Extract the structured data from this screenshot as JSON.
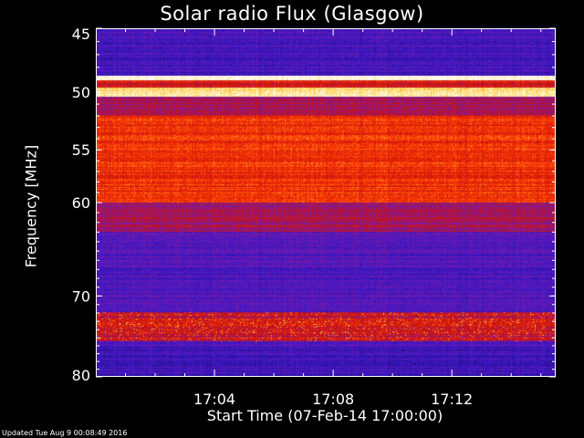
{
  "chart_data": {
    "type": "heatmap",
    "title": "Solar radio Flux (Glasgow)",
    "xlabel": "Start Time (07-Feb-14 17:00:00)",
    "ylabel": "Frequency [MHz]",
    "x_range_minutes": [
      0,
      15.5
    ],
    "x_ticks": [
      {
        "minutes": 4,
        "label": "17:04"
      },
      {
        "minutes": 8,
        "label": "17:08"
      },
      {
        "minutes": 12,
        "label": "17:12"
      }
    ],
    "y_range_mhz": [
      45,
      80
    ],
    "y_scale": "log",
    "y_ticks": [
      {
        "mhz": 45,
        "label": "45"
      },
      {
        "mhz": 50,
        "label": "50"
      },
      {
        "mhz": 55,
        "label": "55"
      },
      {
        "mhz": 60,
        "label": "60"
      },
      {
        "mhz": 70,
        "label": "70"
      },
      {
        "mhz": 80,
        "label": "80"
      }
    ],
    "colormap": [
      "#1e0a6e",
      "#3a18c8",
      "#7a1aa8",
      "#c81010",
      "#ff3c00",
      "#ffd040",
      "#ffffff"
    ],
    "bands": [
      {
        "from_mhz": 45,
        "to_mhz": 48.5,
        "level": 0.18
      },
      {
        "from_mhz": 48.6,
        "to_mhz": 49.0,
        "level": 1.0
      },
      {
        "from_mhz": 49.0,
        "to_mhz": 49.6,
        "level": 0.55
      },
      {
        "from_mhz": 49.6,
        "to_mhz": 50.3,
        "level": 0.9
      },
      {
        "from_mhz": 50.3,
        "to_mhz": 52.0,
        "level": 0.42
      },
      {
        "from_mhz": 52.0,
        "to_mhz": 60.0,
        "level": 0.62
      },
      {
        "from_mhz": 60.0,
        "to_mhz": 63.0,
        "level": 0.42
      },
      {
        "from_mhz": 63.0,
        "to_mhz": 72.0,
        "level": 0.22
      },
      {
        "from_mhz": 72.0,
        "to_mhz": 75.5,
        "level": 0.5
      },
      {
        "from_mhz": 75.5,
        "to_mhz": 80.0,
        "level": 0.18
      }
    ]
  },
  "footer": {
    "text": "Updated Tue Aug  9 00:08:49 2016"
  }
}
